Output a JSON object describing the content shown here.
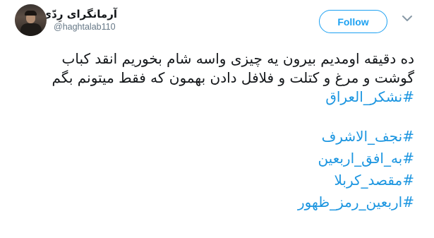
{
  "user": {
    "display_name": "آرمانگرای رِدّی",
    "handle": "@haghtalab110"
  },
  "follow_label": "Follow",
  "tweet": {
    "lines": [
      "ده دقیقه اومدیم بیرون یه چیزی واسه شام بخوریم انقد کباب",
      "گوشت و مرغ و کتلت و فلافل دادن بهمون که فقط میتونم بگم"
    ],
    "hashtags_top": [
      "#نشکر_العراق"
    ],
    "hashtags_bottom": [
      "#نجف_الاشرف",
      "#به_افق_اربعین",
      "#مقصد_کربلا",
      "#اربعین_رمز_ظهور"
    ]
  },
  "icons": {
    "avatar": "user-avatar",
    "chevron": "chevron-down-icon"
  },
  "colors": {
    "accent": "#1da1f2",
    "hashtag": "#1b95e0",
    "text": "#14171a",
    "secondary": "#657786"
  }
}
